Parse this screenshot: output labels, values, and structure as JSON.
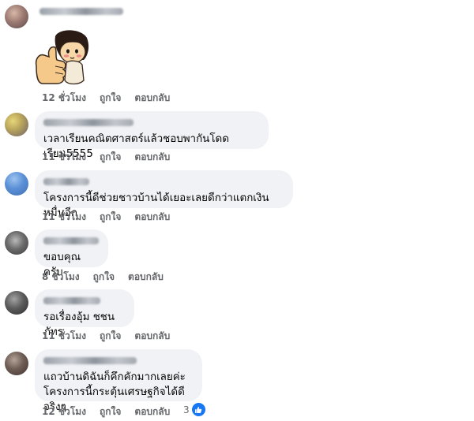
{
  "comments": [
    {
      "text": "",
      "time": "12 ชั่วโมง",
      "like_label": "ถูกใจ",
      "reply_label": "ตอบกลับ",
      "has_sticker": true
    },
    {
      "text": "เวลาเรียนคณิตศาสตร์แล้วชอบพากันโดดเรียน5555",
      "time": "11 ชั่วโมง",
      "like_label": "ถูกใจ",
      "reply_label": "ตอบกลับ"
    },
    {
      "text": "โครงการนี้ดีช่วยชาวบ้านได้เยอะเลยดีกว่าแตกเงินหมื่นอีก",
      "time": "11 ชั่วโมง",
      "like_label": "ถูกใจ",
      "reply_label": "ตอบกลับ"
    },
    {
      "text": "ขอบคุณครับ",
      "time": "8 ชั่วโมง",
      "like_label": "ถูกใจ",
      "reply_label": "ตอบกลับ"
    },
    {
      "text": "รอเรื่องอุ้ม ชชนภัทร",
      "time": "11 ชั่วโมง",
      "like_label": "ถูกใจ",
      "reply_label": "ตอบกลับ"
    },
    {
      "text": "แถวบ้านดิฉันก็คึกคักมากเลยค่ะ\nโครงการนี้กระตุ้นเศรษฐกิจได้ดีจริงๆ",
      "time": "12 ชั่วโมง",
      "like_label": "ถูกใจ",
      "reply_label": "ตอบกลับ",
      "reaction_count": "3",
      "reaction_icon": "thumbs-up-icon"
    }
  ],
  "colors": {
    "bubble": "#f0f2f5",
    "meta_text": "#65676b",
    "like_blue": "#1877f2"
  }
}
